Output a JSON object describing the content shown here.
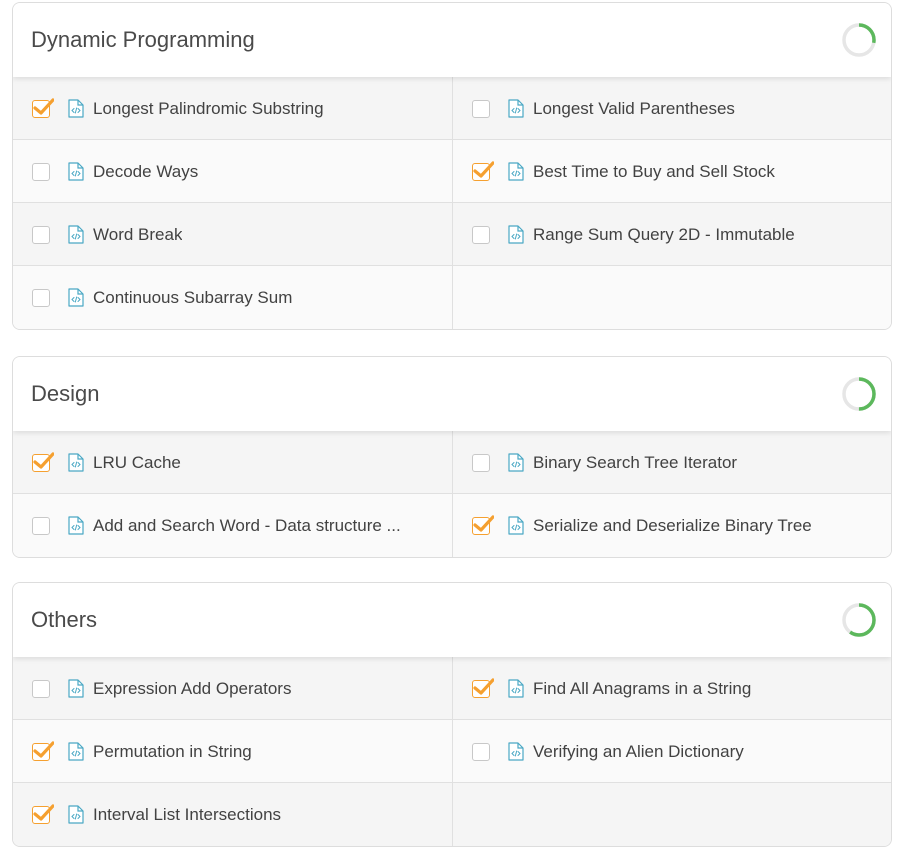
{
  "sections": [
    {
      "title": "Dynamic Programming",
      "progress": 0.28,
      "questions": [
        {
          "label": "Longest Palindromic Substring",
          "checked": true
        },
        {
          "label": "Longest Valid Parentheses",
          "checked": false
        },
        {
          "label": "Decode Ways",
          "checked": false
        },
        {
          "label": "Best Time to Buy and Sell Stock",
          "checked": true
        },
        {
          "label": "Word Break",
          "checked": false
        },
        {
          "label": "Range Sum Query 2D - Immutable",
          "checked": false
        },
        {
          "label": "Continuous Subarray Sum",
          "checked": false
        }
      ]
    },
    {
      "title": "Design",
      "progress": 0.5,
      "questions": [
        {
          "label": "LRU Cache",
          "checked": true
        },
        {
          "label": "Binary Search Tree Iterator",
          "checked": false
        },
        {
          "label": "Add and Search Word - Data structure ...",
          "checked": false
        },
        {
          "label": "Serialize and Deserialize Binary Tree",
          "checked": true
        }
      ]
    },
    {
      "title": "Others",
      "progress": 0.6,
      "questions": [
        {
          "label": "Expression Add Operators",
          "checked": false
        },
        {
          "label": "Find All Anagrams in a String",
          "checked": true
        },
        {
          "label": "Permutation in String",
          "checked": true
        },
        {
          "label": "Verifying an Alien Dictionary",
          "checked": false
        },
        {
          "label": "Interval List Intersections",
          "checked": true
        }
      ]
    }
  ],
  "colors": {
    "progress_fill": "#5cb85c",
    "progress_track": "#e6e6e6",
    "checkbox_checked": "#f5a030",
    "doc_icon": "#4aa8c4"
  },
  "icons": {
    "file": "file-code-icon",
    "check": "checkmark-icon"
  }
}
